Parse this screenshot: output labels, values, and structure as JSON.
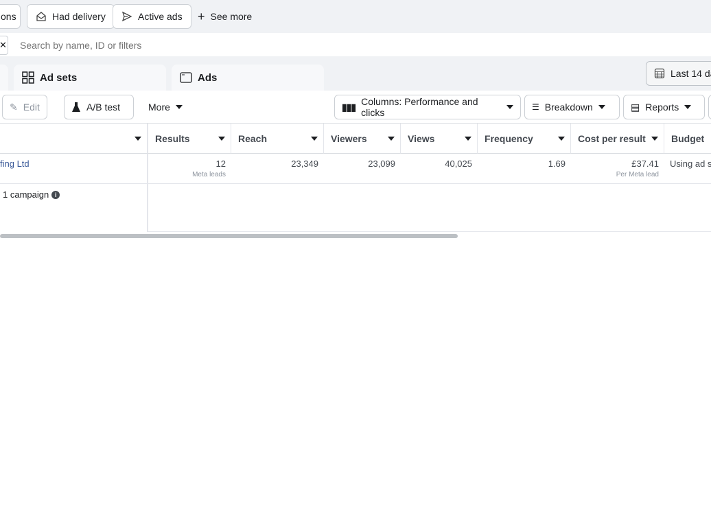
{
  "filters": {
    "chip_partial": "ons",
    "had_delivery": "Had delivery",
    "active_ads": "Active ads",
    "see_more": "See more"
  },
  "search": {
    "placeholder": "Search by name, ID or filters"
  },
  "tabs": {
    "ad_sets": "Ad sets",
    "ads": "Ads"
  },
  "date_range": "Last 14 da",
  "toolbar": {
    "edit": "Edit",
    "ab_test": "A/B test",
    "more": "More",
    "columns": "Columns: Performance and clicks",
    "breakdown": "Breakdown",
    "reports": "Reports"
  },
  "table": {
    "headers": [
      "Results",
      "Reach",
      "Viewers",
      "Views",
      "Frequency",
      "Cost per result",
      "Budget"
    ],
    "row": {
      "name": "fing Ltd",
      "results": "12",
      "results_sub": "Meta leads",
      "reach": "23,349",
      "viewers": "23,099",
      "views": "40,025",
      "frequency": "1.69",
      "cost": "£37.41",
      "cost_sub": "Per Meta lead",
      "budget": "Using ad s"
    },
    "footer": "1 campaign"
  }
}
